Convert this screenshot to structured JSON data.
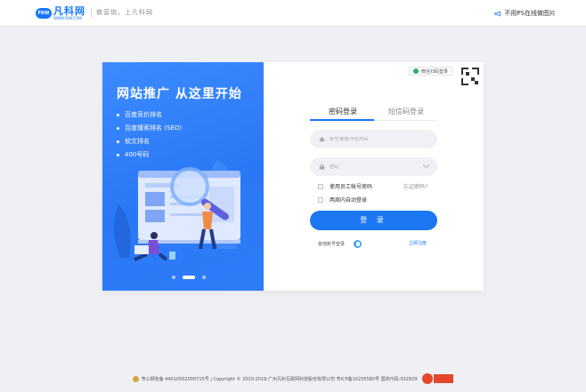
{
  "header": {
    "logo_badge": "FKW",
    "logo_name": "凡科网",
    "logo_url": "WWW.FKW.COM",
    "slogan": "做营销，上凡科网",
    "link_label": "不用PS在线做图片"
  },
  "promo": {
    "title": "网站推广 从这里开始",
    "items": [
      "百度竞价排名",
      "百度搜索排名 (SEO)",
      "软文排名",
      "400号码"
    ],
    "active_slide": 2,
    "slide_count": 3
  },
  "login": {
    "qr_chip_label": "微信扫码登录",
    "tabs": [
      {
        "label": "密码登录",
        "active": true
      },
      {
        "label": "短信码登录",
        "active": false
      }
    ],
    "account_placeholder": "帐号/邮箱/手机号码",
    "password_placeholder": "密码",
    "employee_option": "使用员工帐号密码",
    "forgot_label": "忘记密码?",
    "auto_login_option": "两周内自动登录",
    "submit_label": "登 录",
    "other_login_label": "其他账号登录",
    "register_label": "立即注册"
  },
  "footer": {
    "text": "粤公网安备 44010502000715号 | Copyright © 2010-2019 广州凡科互联网科技股份有限公司 粤ICP备10235580号 国资代码:932829"
  },
  "colors": {
    "accent": "#1677ff",
    "promo_bg": "#2e7cf8",
    "page_bg": "#eef0f4",
    "wechat": "#2aae67"
  }
}
